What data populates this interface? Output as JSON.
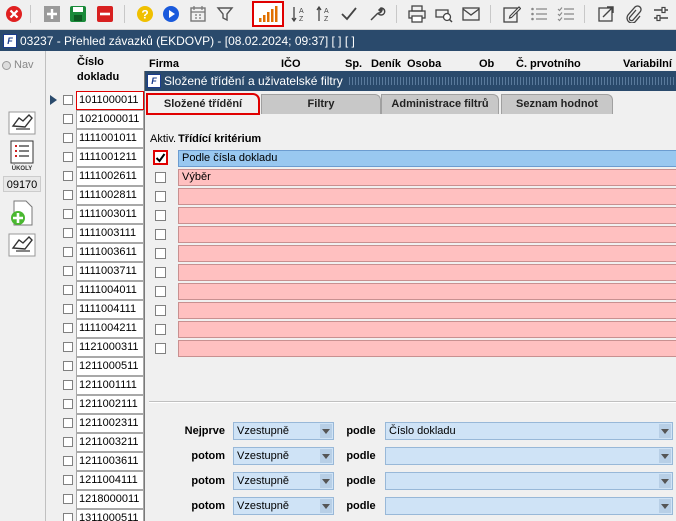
{
  "toolbar": {
    "icons": [
      "close-icon",
      "add-icon",
      "save-icon",
      "delete-icon",
      "help-icon",
      "run-icon",
      "calendar-icon",
      "filter-icon",
      "signal-icon",
      "sort-az-icon",
      "sort-za-icon",
      "check-icon",
      "wrench-icon",
      "print-icon",
      "print-preview-icon",
      "mail-icon",
      "edit-icon",
      "list-icon",
      "checklist-icon",
      "external-link-icon",
      "attachment-icon",
      "settings-icon"
    ],
    "accent": "#e00000"
  },
  "window": {
    "title": "03237 - Přehled závazků (EKDOVP) - [08.02.2024; 09:37]  [ ]  [ ]"
  },
  "left_panel": {
    "nav_label": "Nav",
    "ukoly_label": "ÚKOLY",
    "filter_count": "09170"
  },
  "list": {
    "columns": {
      "doc_number": "Číslo\ndokladu",
      "doc_number_l1": "Číslo",
      "doc_number_l2": "dokladu",
      "firm": "Firma",
      "ico": "IČO",
      "sp": "Sp.",
      "denik": "Deník",
      "osoba": "Osoba",
      "ob": "Ob",
      "c_prvotniho": "Č. prvotního",
      "variabilni": "Variabilní"
    },
    "rows": [
      "1011000011",
      "1021000011",
      "1111001011",
      "1111001211",
      "1111002611",
      "1111002811",
      "1111003011",
      "1111003111",
      "1111003611",
      "1111003711",
      "1111004011",
      "1111004111",
      "1111004211",
      "1121000311",
      "1211000511",
      "1211001111",
      "1211002111",
      "1211002311",
      "1211003211",
      "1211003611",
      "1211004111",
      "1218000011",
      "1311000511"
    ]
  },
  "modal": {
    "title": "Složené třídění a uživatelské filtry",
    "tabs": [
      "Složené třídění",
      "Filtry",
      "Administrace filtrů",
      "Seznam hodnot"
    ],
    "criteria_header_activ": "Aktiv.",
    "criteria_header_title": "Třídící kritérium",
    "criteria": [
      {
        "label": "Podle čísla dokladu",
        "checked": true
      },
      {
        "label": "Výběr",
        "checked": false
      },
      {
        "label": "",
        "checked": false
      },
      {
        "label": "",
        "checked": false
      },
      {
        "label": "",
        "checked": false
      },
      {
        "label": "",
        "checked": false
      },
      {
        "label": "",
        "checked": false
      },
      {
        "label": "",
        "checked": false
      },
      {
        "label": "",
        "checked": false
      },
      {
        "label": "",
        "checked": false
      },
      {
        "label": "",
        "checked": false
      }
    ],
    "sort_rows": [
      {
        "label": "Nejprve",
        "direction": "Vzestupně",
        "podle": "podle",
        "field": "Číslo dokladu"
      },
      {
        "label": "potom",
        "direction": "Vzestupně",
        "podle": "podle",
        "field": ""
      },
      {
        "label": "potom",
        "direction": "Vzestupně",
        "podle": "podle",
        "field": ""
      },
      {
        "label": "potom",
        "direction": "Vzestupně",
        "podle": "podle",
        "field": ""
      }
    ]
  }
}
